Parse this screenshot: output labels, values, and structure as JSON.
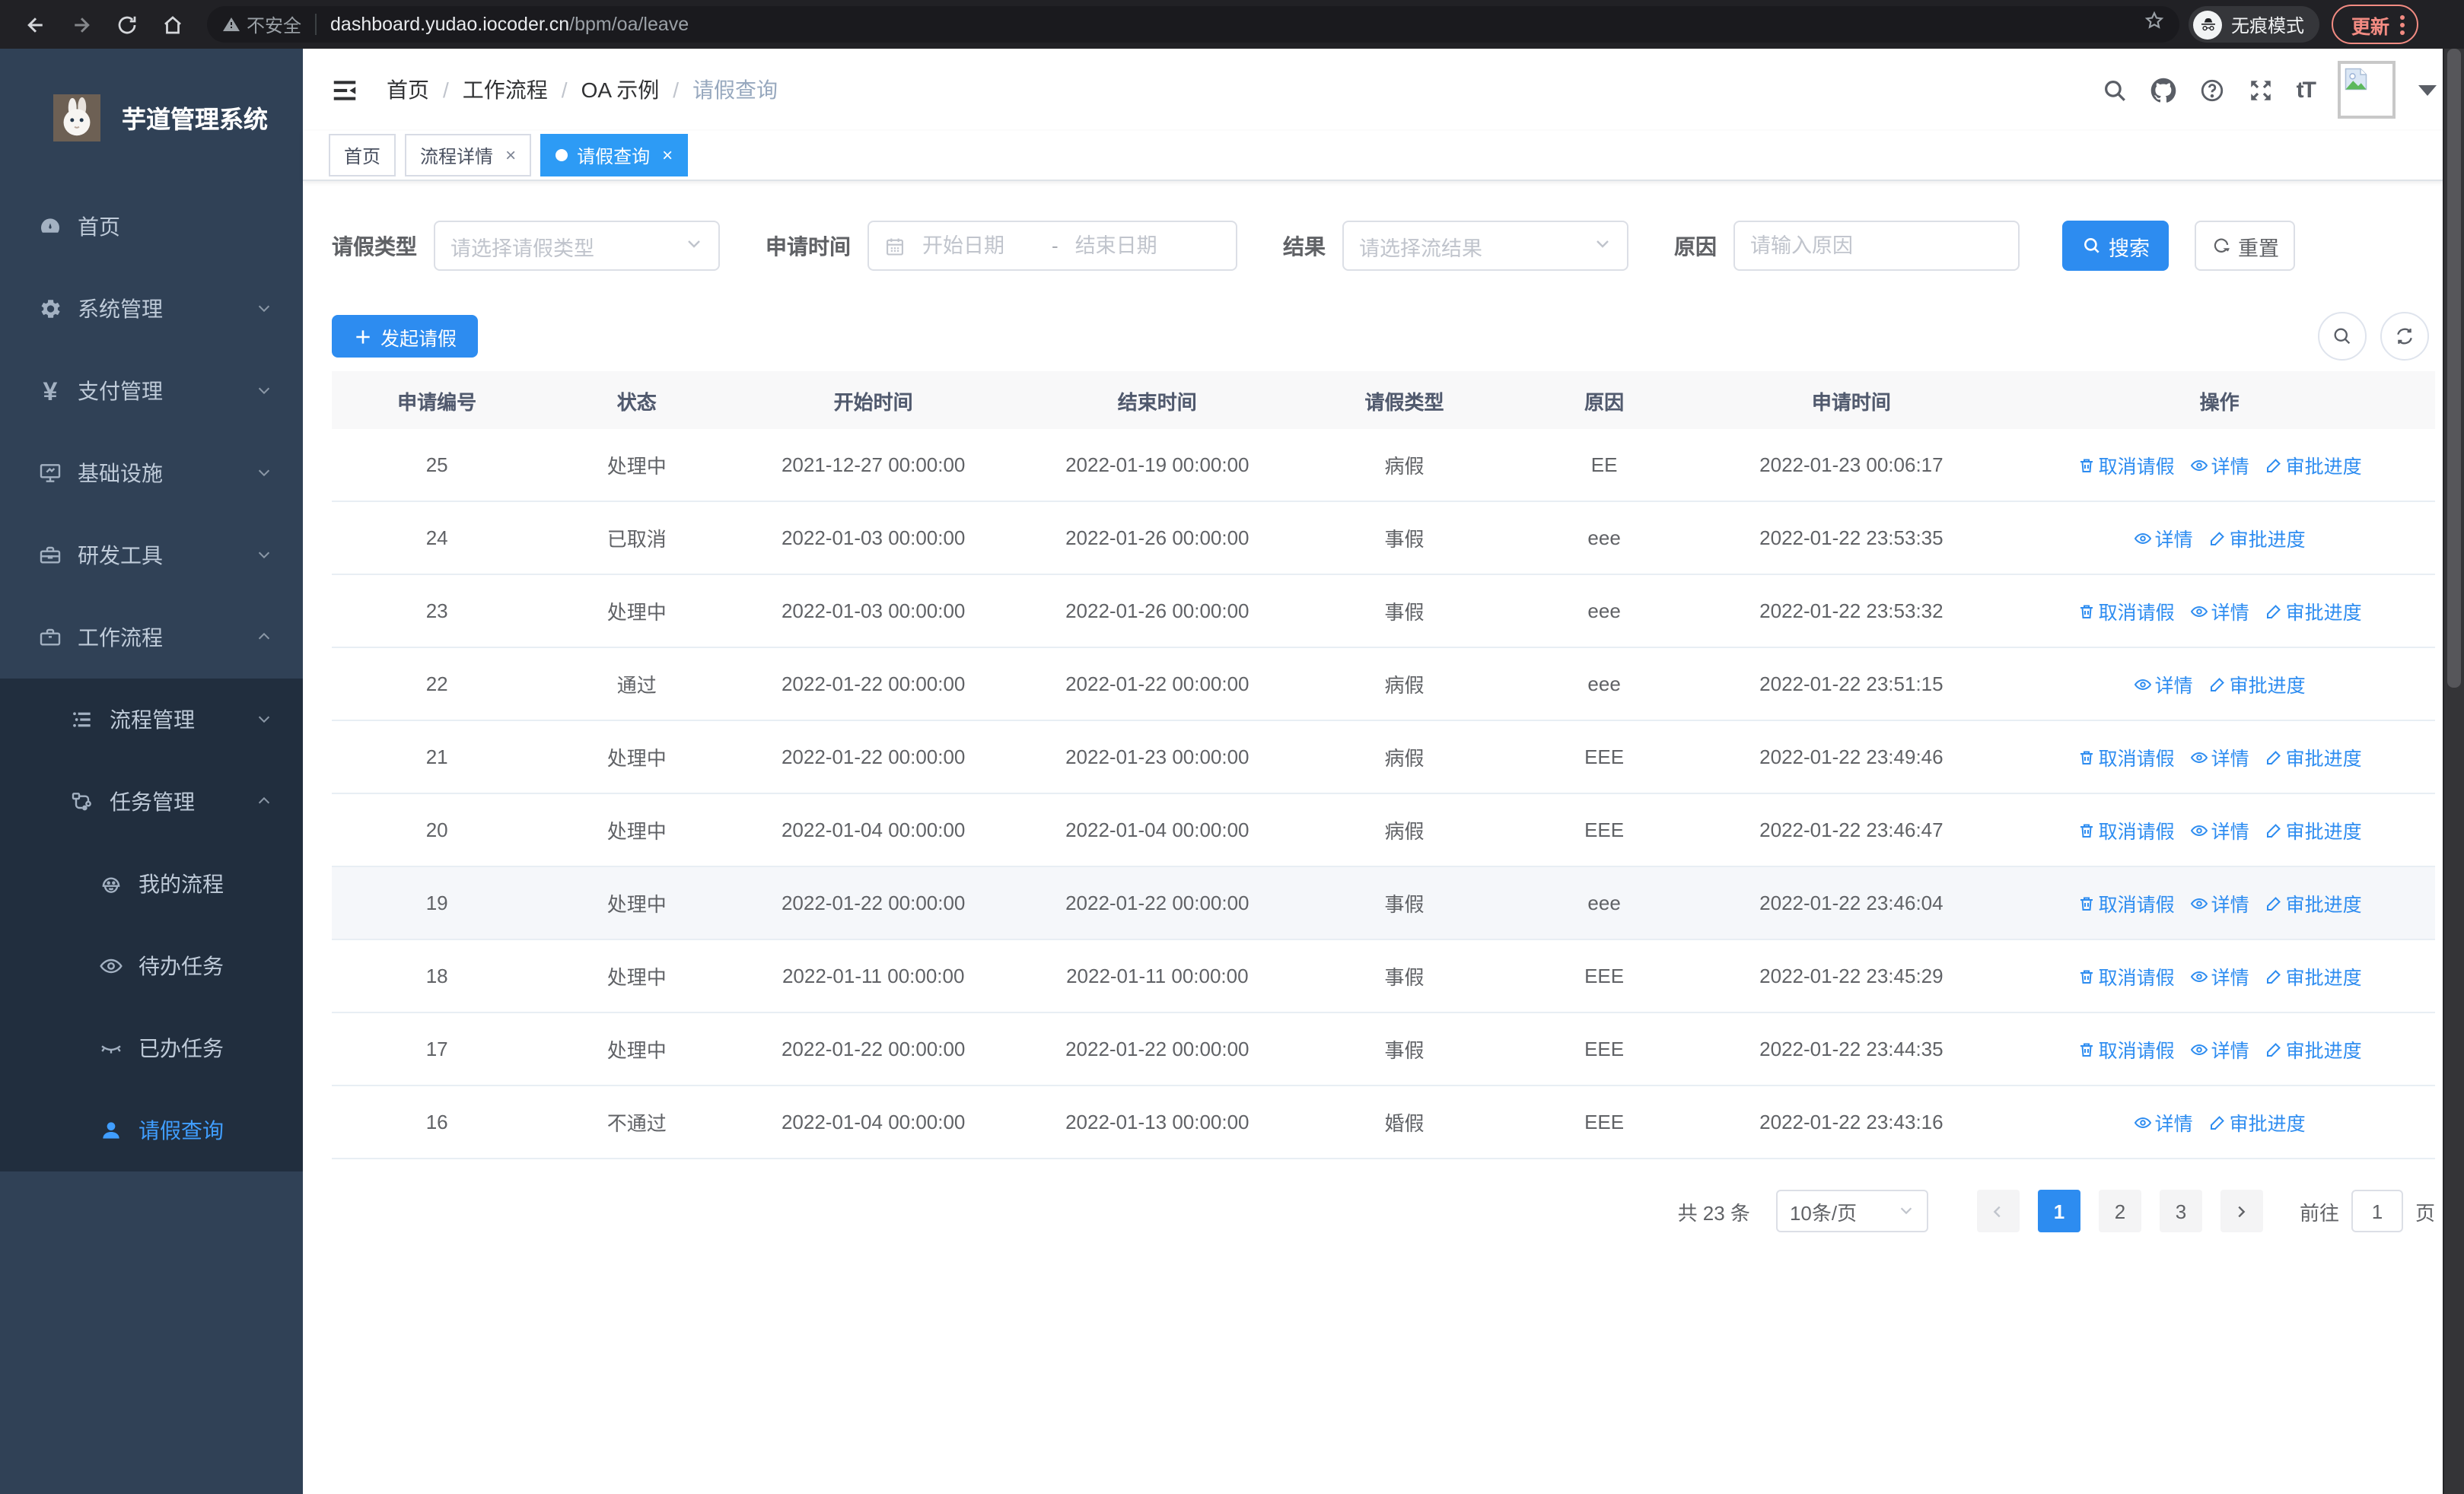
{
  "browser": {
    "security_label": "不安全",
    "url_host": "dashboard.yudao.iocoder.cn",
    "url_path": "/bpm/oa/leave",
    "incognito_label": "无痕模式",
    "update_label": "更新"
  },
  "sidebar": {
    "title": "芋道管理系统",
    "items": [
      {
        "label": "首页",
        "icon": "dashboard-icon",
        "depth": 0,
        "sub": false,
        "active": false,
        "chevron": ""
      },
      {
        "label": "系统管理",
        "icon": "gear-icon",
        "depth": 0,
        "sub": false,
        "active": false,
        "chevron": "down"
      },
      {
        "label": "支付管理",
        "icon": "yen-icon",
        "depth": 0,
        "sub": false,
        "active": false,
        "chevron": "down"
      },
      {
        "label": "基础设施",
        "icon": "monitor-icon",
        "depth": 0,
        "sub": false,
        "active": false,
        "chevron": "down"
      },
      {
        "label": "研发工具",
        "icon": "toolbox-icon",
        "depth": 0,
        "sub": false,
        "active": false,
        "chevron": "down"
      },
      {
        "label": "工作流程",
        "icon": "briefcase-icon",
        "depth": 0,
        "sub": false,
        "active": false,
        "chevron": "up"
      },
      {
        "label": "流程管理",
        "icon": "list-icon",
        "depth": 1,
        "sub": true,
        "active": false,
        "chevron": "down"
      },
      {
        "label": "任务管理",
        "icon": "flow-icon",
        "depth": 1,
        "sub": true,
        "active": false,
        "chevron": "up"
      },
      {
        "label": "我的流程",
        "icon": "face-icon",
        "depth": 2,
        "sub": true,
        "active": false,
        "chevron": ""
      },
      {
        "label": "待办任务",
        "icon": "eye-icon",
        "depth": 2,
        "sub": true,
        "active": false,
        "chevron": ""
      },
      {
        "label": "已办任务",
        "icon": "eye-closed-icon",
        "depth": 2,
        "sub": true,
        "active": false,
        "chevron": ""
      },
      {
        "label": "请假查询",
        "icon": "user-icon",
        "depth": 2,
        "sub": true,
        "active": true,
        "chevron": ""
      }
    ]
  },
  "header": {
    "breadcrumb": [
      "首页",
      "工作流程",
      "OA 示例",
      "请假查询"
    ],
    "separator": "/",
    "icons": [
      "search-icon",
      "github-icon",
      "help-icon",
      "fullscreen-icon",
      "font-size-icon"
    ]
  },
  "tabs": [
    {
      "label": "首页",
      "closable": false,
      "active": false
    },
    {
      "label": "流程详情",
      "closable": true,
      "active": false
    },
    {
      "label": "请假查询",
      "closable": true,
      "active": true
    }
  ],
  "filters": {
    "leave_type": {
      "label": "请假类型",
      "placeholder": "请选择请假类型"
    },
    "apply_time": {
      "label": "申请时间",
      "start_placeholder": "开始日期",
      "separator": "-",
      "end_placeholder": "结束日期"
    },
    "result": {
      "label": "结果",
      "placeholder": "请选择流结果"
    },
    "reason": {
      "label": "原因",
      "placeholder": "请输入原因"
    },
    "search_label": "搜索",
    "reset_label": "重置"
  },
  "toolbar": {
    "create_label": "发起请假"
  },
  "table": {
    "columns": [
      "申请编号",
      "状态",
      "开始时间",
      "结束时间",
      "请假类型",
      "原因",
      "申请时间",
      "操作"
    ],
    "action_labels": {
      "cancel": "取消请假",
      "detail": "详情",
      "progress": "审批进度"
    },
    "rows": [
      {
        "id": "25",
        "status": "处理中",
        "start": "2021-12-27 00:00:00",
        "end": "2022-01-19 00:00:00",
        "type": "病假",
        "reason": "EE",
        "applied": "2022-01-23 00:06:17",
        "actions": [
          "cancel",
          "detail",
          "progress"
        ],
        "highlight": false
      },
      {
        "id": "24",
        "status": "已取消",
        "start": "2022-01-03 00:00:00",
        "end": "2022-01-26 00:00:00",
        "type": "事假",
        "reason": "eee",
        "applied": "2022-01-22 23:53:35",
        "actions": [
          "detail",
          "progress"
        ],
        "highlight": false
      },
      {
        "id": "23",
        "status": "处理中",
        "start": "2022-01-03 00:00:00",
        "end": "2022-01-26 00:00:00",
        "type": "事假",
        "reason": "eee",
        "applied": "2022-01-22 23:53:32",
        "actions": [
          "cancel",
          "detail",
          "progress"
        ],
        "highlight": false
      },
      {
        "id": "22",
        "status": "通过",
        "start": "2022-01-22 00:00:00",
        "end": "2022-01-22 00:00:00",
        "type": "病假",
        "reason": "eee",
        "applied": "2022-01-22 23:51:15",
        "actions": [
          "detail",
          "progress"
        ],
        "highlight": false
      },
      {
        "id": "21",
        "status": "处理中",
        "start": "2022-01-22 00:00:00",
        "end": "2022-01-23 00:00:00",
        "type": "病假",
        "reason": "EEE",
        "applied": "2022-01-22 23:49:46",
        "actions": [
          "cancel",
          "detail",
          "progress"
        ],
        "highlight": false
      },
      {
        "id": "20",
        "status": "处理中",
        "start": "2022-01-04 00:00:00",
        "end": "2022-01-04 00:00:00",
        "type": "病假",
        "reason": "EEE",
        "applied": "2022-01-22 23:46:47",
        "actions": [
          "cancel",
          "detail",
          "progress"
        ],
        "highlight": false
      },
      {
        "id": "19",
        "status": "处理中",
        "start": "2022-01-22 00:00:00",
        "end": "2022-01-22 00:00:00",
        "type": "事假",
        "reason": "eee",
        "applied": "2022-01-22 23:46:04",
        "actions": [
          "cancel",
          "detail",
          "progress"
        ],
        "highlight": true
      },
      {
        "id": "18",
        "status": "处理中",
        "start": "2022-01-11 00:00:00",
        "end": "2022-01-11 00:00:00",
        "type": "事假",
        "reason": "EEE",
        "applied": "2022-01-22 23:45:29",
        "actions": [
          "cancel",
          "detail",
          "progress"
        ],
        "highlight": false
      },
      {
        "id": "17",
        "status": "处理中",
        "start": "2022-01-22 00:00:00",
        "end": "2022-01-22 00:00:00",
        "type": "事假",
        "reason": "EEE",
        "applied": "2022-01-22 23:44:35",
        "actions": [
          "cancel",
          "detail",
          "progress"
        ],
        "highlight": false
      },
      {
        "id": "16",
        "status": "不通过",
        "start": "2022-01-04 00:00:00",
        "end": "2022-01-13 00:00:00",
        "type": "婚假",
        "reason": "EEE",
        "applied": "2022-01-22 23:43:16",
        "actions": [
          "detail",
          "progress"
        ],
        "highlight": false
      }
    ]
  },
  "pagination": {
    "total_label": "共 23 条",
    "page_size_label": "10条/页",
    "pages": [
      "1",
      "2",
      "3"
    ],
    "active_page": "1",
    "goto_label": "前往",
    "goto_value": "1",
    "unit_label": "页"
  },
  "colors": {
    "primary": "#2d8cf0",
    "sidebar_bg": "#304156",
    "sidebar_sub_bg": "#212e3e",
    "active_tab_bg": "#2d9bf5"
  }
}
